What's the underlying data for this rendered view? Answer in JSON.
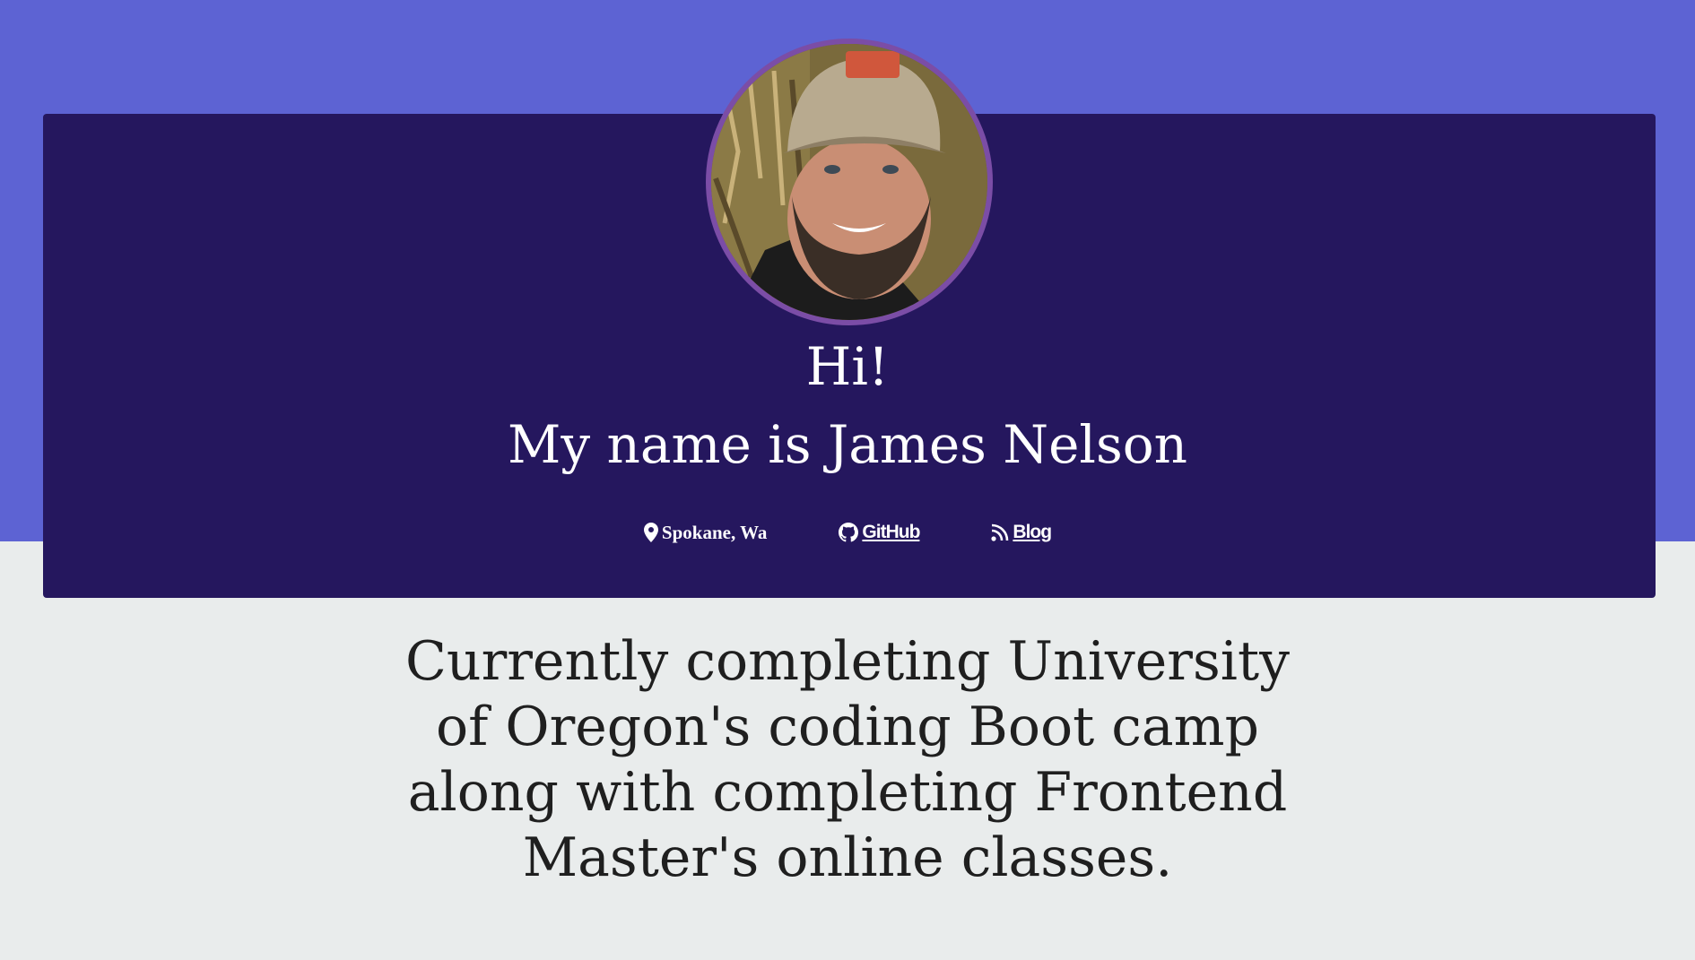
{
  "header": {
    "greeting": "Hi!",
    "intro": "My name is James Nelson"
  },
  "avatar": {
    "alt": "James Nelson profile photo"
  },
  "links": {
    "location": "Spokane, Wa",
    "github": "GitHub",
    "blog": "Blog"
  },
  "bio": {
    "text": "Currently completing University of Oregon's coding Boot camp along with completing Frontend Master's online classes."
  },
  "colors": {
    "hero_background": "#5d63d3",
    "card_background": "#25175e",
    "avatar_border": "#7b4da6",
    "page_background": "#e9ecec"
  },
  "icons": [
    "map-pin-icon",
    "github-icon",
    "rss-icon"
  ]
}
